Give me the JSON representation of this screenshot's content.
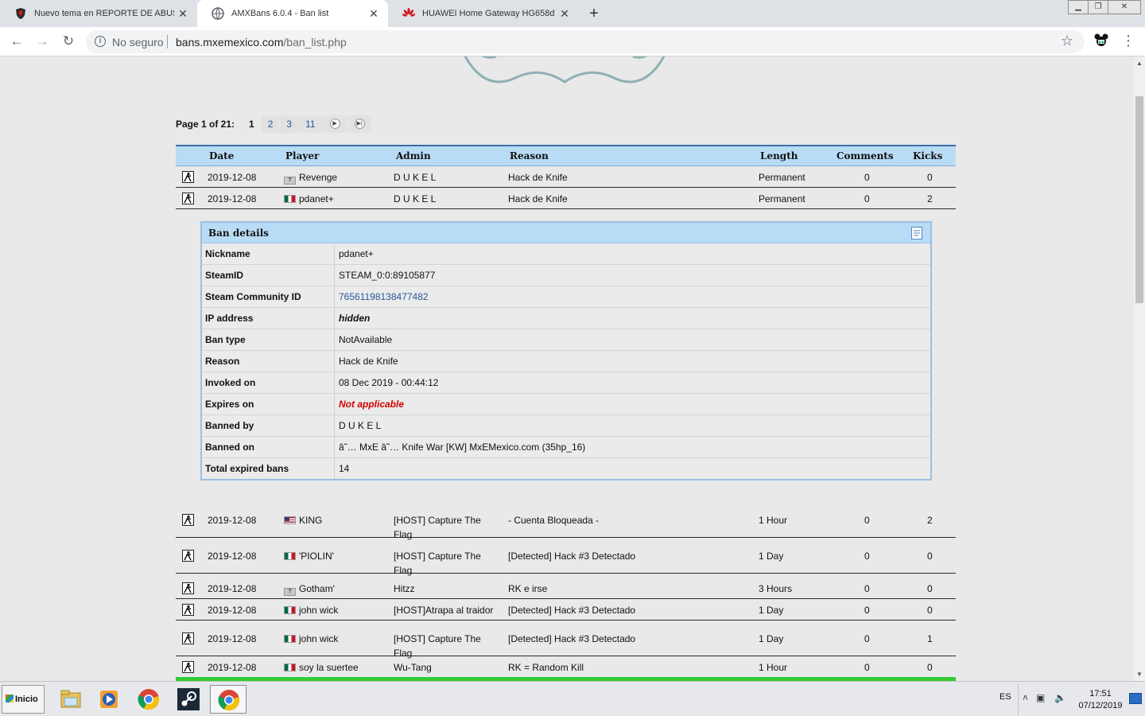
{
  "browser": {
    "tabs": [
      {
        "title": "Nuevo tema en REPORTE DE ABUSO",
        "active": false
      },
      {
        "title": "AMXBans 6.0.4 - Ban list",
        "active": true
      },
      {
        "title": "HUAWEI Home Gateway HG658d",
        "active": false
      }
    ],
    "address": {
      "security_label": "No seguro",
      "host": "bans.mxemexico.com",
      "path": "/ban_list.php"
    }
  },
  "pager": {
    "label": "Page 1 of 21:",
    "current": "1",
    "pages": [
      "2",
      "3",
      "11"
    ]
  },
  "table": {
    "headers": [
      "Date",
      "Player",
      "Admin",
      "Reason",
      "Length",
      "Comments",
      "Kicks"
    ]
  },
  "bans_top": [
    {
      "date": "2019-12-08",
      "flag": "unknown",
      "player": "Revenge",
      "admin": "D U K E L",
      "reason": "Hack de Knife",
      "length": "Permanent",
      "comments": "0",
      "kicks": "0"
    },
    {
      "date": "2019-12-08",
      "flag": "mx",
      "player": "pdanet+",
      "admin": "D U K E L",
      "reason": "Hack de Knife",
      "length": "Permanent",
      "comments": "0",
      "kicks": "2"
    }
  ],
  "details": {
    "title": "Ban details",
    "rows": [
      {
        "label": "Nickname",
        "value": "pdanet+"
      },
      {
        "label": "SteamID",
        "value": "STEAM_0:0:89105877"
      },
      {
        "label": "Steam Community ID",
        "value": "76561198138477482"
      },
      {
        "label": "IP address",
        "value": "hidden"
      },
      {
        "label": "Ban type",
        "value": "NotAvailable"
      },
      {
        "label": "Reason",
        "value": "Hack de Knife"
      },
      {
        "label": "Invoked on",
        "value": "08 Dec 2019 - 00:44:12"
      },
      {
        "label": "Expires on",
        "value": "Not applicable"
      },
      {
        "label": "Banned by",
        "value": "D U K E L"
      },
      {
        "label": "Banned on",
        "value": "â˜… MxE â˜… Knife War [KW] MxEMexico.com (35hp_16)"
      },
      {
        "label": "Total expired bans",
        "value": "14"
      }
    ]
  },
  "bans_bottom": [
    {
      "date": "2019-12-08",
      "flag": "us",
      "player": "KING",
      "admin": "[HOST] Capture The Flag",
      "reason": "- Cuenta Bloqueada -",
      "length": "1 Hour",
      "comments": "0",
      "kicks": "2"
    },
    {
      "date": "2019-12-08",
      "flag": "mx",
      "player": "'PIOLIN'",
      "admin": "[HOST] Capture The Flag",
      "reason": "[Detected] Hack #3 Detectado",
      "length": "1 Day",
      "comments": "0",
      "kicks": "0"
    },
    {
      "date": "2019-12-08",
      "flag": "unknown",
      "player": "Gotham'",
      "admin": "Hitzz",
      "reason": "RK e irse",
      "length": "3 Hours",
      "comments": "0",
      "kicks": "0"
    },
    {
      "date": "2019-12-08",
      "flag": "mx",
      "player": "john wick",
      "admin": "[HOST]Atrapa al traidor",
      "reason": "[Detected] Hack #3 Detectado",
      "length": "1 Day",
      "comments": "0",
      "kicks": "0"
    },
    {
      "date": "2019-12-08",
      "flag": "mx",
      "player": "john wick",
      "admin": "[HOST] Capture The Flag",
      "reason": "[Detected] Hack #3 Detectado",
      "length": "1 Day",
      "comments": "0",
      "kicks": "1"
    },
    {
      "date": "2019-12-08",
      "flag": "mx",
      "player": "soy la suertee",
      "admin": "Wu-Tang",
      "reason": "RK = Random Kill",
      "length": "1 Hour",
      "comments": "0",
      "kicks": "0"
    }
  ],
  "taskbar": {
    "start_label": "Inicio",
    "lang": "ES",
    "time": "17:51",
    "date": "07/12/2019"
  },
  "icons": {
    "tab1": "shield-icon",
    "tab2": "chrome-page-icon",
    "tab3": "huawei-icon",
    "row": "counter-strike-icon",
    "details": "document-icon"
  }
}
